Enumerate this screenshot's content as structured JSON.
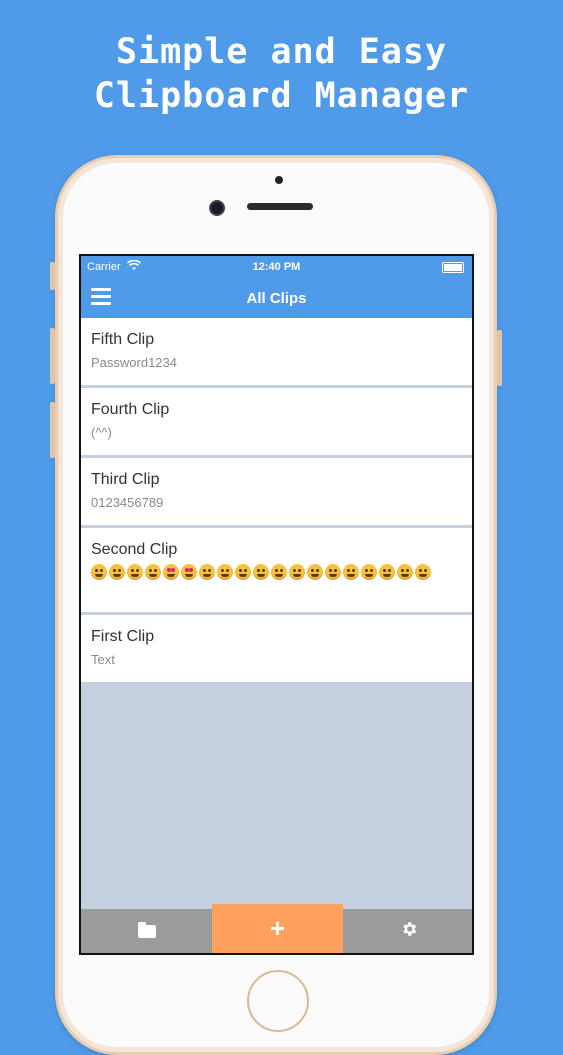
{
  "headline": {
    "line1": "Simple and Easy",
    "line2": "Clipboard Manager"
  },
  "status_bar": {
    "carrier": "Carrier",
    "time": "12:40 PM",
    "wifi_icon": "wifi-icon",
    "battery_icon": "battery-icon"
  },
  "nav": {
    "title": "All Clips",
    "menu_icon": "hamburger-menu-icon"
  },
  "clips": [
    {
      "title": "Fifth Clip",
      "body": "Password1234"
    },
    {
      "title": "Fourth Clip",
      "body": "(^^)"
    },
    {
      "title": "Third Clip",
      "body": "0123456789"
    },
    {
      "title": "Second Clip",
      "body_type": "emoji"
    },
    {
      "title": "First Clip",
      "body": "Text"
    }
  ],
  "tabbar": {
    "folder_icon": "folder-icon",
    "add_label": "+",
    "settings_icon": "gear-icon"
  },
  "colors": {
    "background": "#4f9bea",
    "nav_blue": "#4f9bea",
    "add_tab": "#ffa15c",
    "tabbar": "#9b9b9b"
  }
}
